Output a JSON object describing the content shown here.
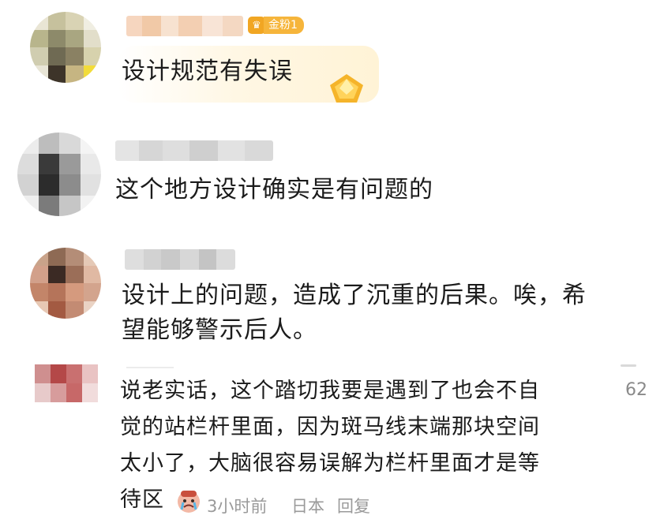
{
  "comments": [
    {
      "text": "设计规范有失误",
      "badge_label": "金粉1",
      "badge_icon": "crown-badge-icon",
      "badge_color": "#f6b53b"
    },
    {
      "text": "这个地方设计确实是有问题的"
    },
    {
      "text_line1": "设计上的问题，造成了沉重的后果。唉，希",
      "text_line2": "望能够警示后人。"
    },
    {
      "text_line1": "说老实话，这个踏切我要是遇到了也会不自",
      "text_line2": "觉的站栏杆里面，因为斑马线末端那块空间",
      "text_line3": "太小了，大脑很容易误解为栏杆里面才是等",
      "text_line4": "待区",
      "emoji": "crying-face-emoji",
      "time": "3小时前",
      "location": "日本",
      "reply_label": "回复",
      "like_count": "62"
    }
  ],
  "colors": {
    "text": "#1b1b1b",
    "meta": "#9a9a9a",
    "gold": "#f6b53b"
  }
}
